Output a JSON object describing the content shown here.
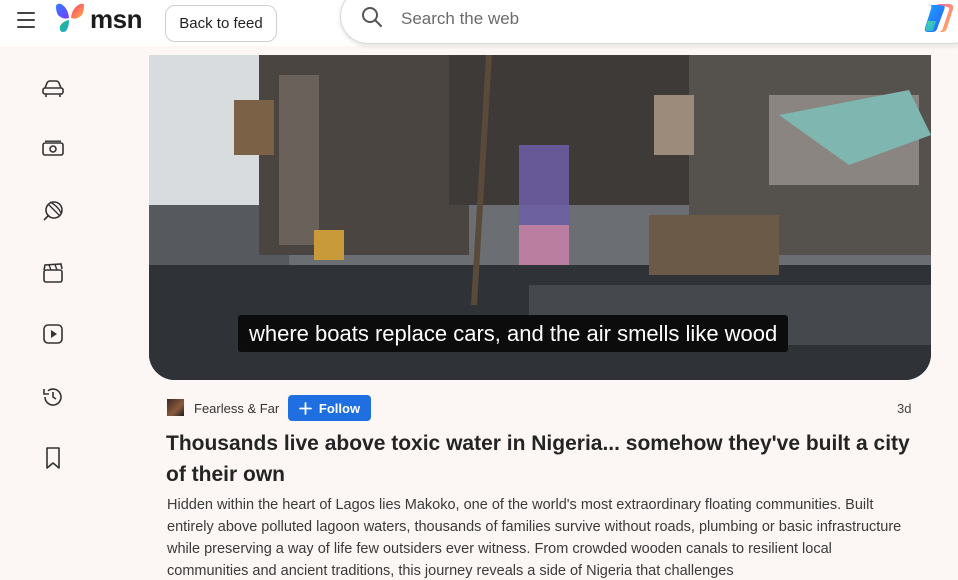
{
  "header": {
    "logo_text": "msn",
    "back_label": "Back to feed",
    "search_placeholder": "Search the web"
  },
  "sidebar": {
    "items": [
      {
        "icon": "car-icon"
      },
      {
        "icon": "money-icon"
      },
      {
        "icon": "sports-ball-icon"
      },
      {
        "icon": "clapperboard-icon"
      },
      {
        "icon": "video-play-icon"
      },
      {
        "icon": "history-icon"
      },
      {
        "icon": "bookmark-icon"
      }
    ]
  },
  "video": {
    "subtitle": "where boats replace cars, and the air smells like wood"
  },
  "article": {
    "source": "Fearless & Far",
    "follow_label": "Follow",
    "age": "3d",
    "title": "Thousands live above toxic water in Nigeria... somehow they've built a city of their own",
    "description": "Hidden within the heart of Lagos lies Makoko, one of the world's most extraordinary floating communities. Built entirely above polluted lagoon waters, thousands of families survive without roads, plumbing or basic infrastructure while preserving a way of life few outsiders ever witness. From crowded wooden canals to resilient local communities and ancient traditions, this journey reveals a side of Nigeria that challenges"
  },
  "colors": {
    "accent": "#1f6fe0",
    "page_bg": "#fcf6f4",
    "header_bg": "#ffffff"
  }
}
